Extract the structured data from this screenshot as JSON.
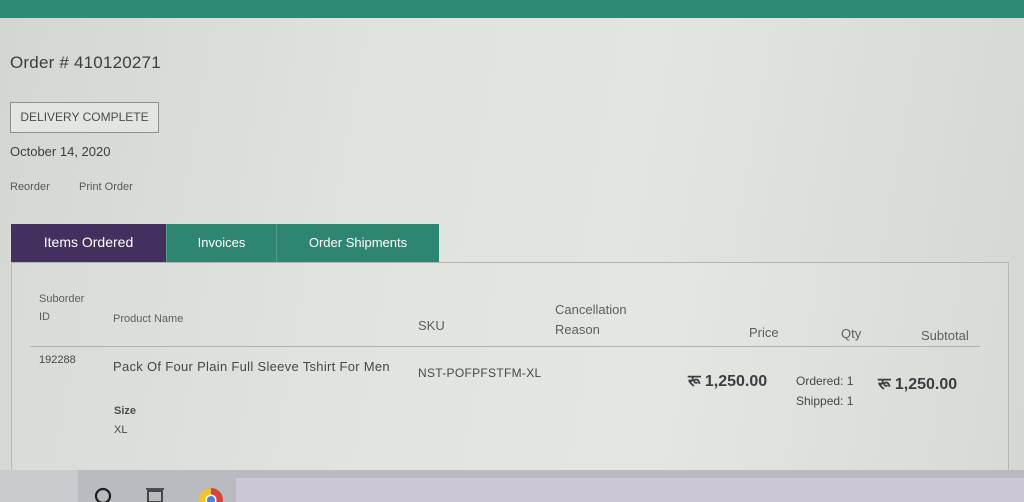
{
  "order": {
    "title": "Order # 410120271",
    "status": "DELIVERY COMPLETE",
    "date": "October 14, 2020",
    "actions": {
      "reorder": "Reorder",
      "print": "Print Order"
    }
  },
  "tabs": [
    {
      "label": "Items Ordered",
      "active": true
    },
    {
      "label": "Invoices",
      "active": false
    },
    {
      "label": "Order Shipments",
      "active": false
    }
  ],
  "table": {
    "headers": {
      "suborder_line1": "Suborder",
      "suborder_line2": "ID",
      "product_name": "Product Name",
      "sku": "SKU",
      "cancellation_line1": "Cancellation",
      "cancellation_line2": "Reason",
      "price": "Price",
      "qty": "Qty",
      "subtotal": "Subtotal"
    },
    "rows": [
      {
        "suborder_id": "192288",
        "product_name": "Pack Of Four Plain Full Sleeve Tshirt For Men",
        "size_label": "Size",
        "size_value": "XL",
        "sku": "NST-POFPFSTFM-XL",
        "cancellation_reason": "",
        "currency": "रू",
        "price": "1,250.00",
        "qty_ordered": "Ordered: 1",
        "qty_shipped": "Shipped: 1",
        "subtotal": "1,250.00"
      }
    ]
  },
  "colors": {
    "top_bar": "#2f8a73",
    "tab_active": "#43305e",
    "tab_inactive": "#2e8670"
  },
  "taskbar": {
    "icons": [
      "cortana-icon",
      "task-view-icon",
      "chrome-icon"
    ]
  }
}
